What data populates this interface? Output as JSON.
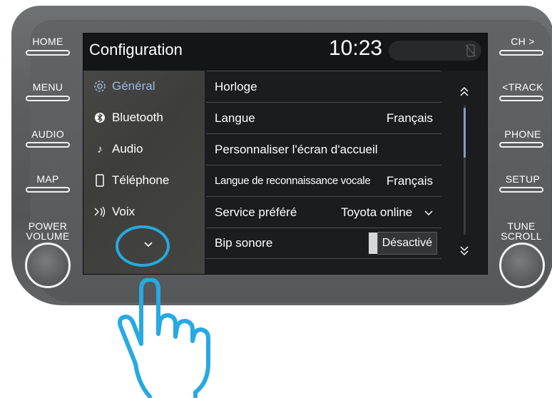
{
  "hardware_buttons": {
    "left": [
      "HOME",
      "MENU",
      "AUDIO",
      "MAP"
    ],
    "right": [
      "CH >",
      "<TRACK",
      "PHONE",
      "SETUP"
    ],
    "left_knob_label": [
      "POWER",
      "VOLUME"
    ],
    "right_knob_label": [
      "TUNE",
      "SCROLL"
    ]
  },
  "screen": {
    "title": "Configuration",
    "clock": "10:23",
    "sidebar": [
      {
        "label": "Général",
        "icon": "gear-icon",
        "active": true
      },
      {
        "label": "Bluetooth",
        "icon": "bluetooth-icon",
        "active": false
      },
      {
        "label": "Audio",
        "icon": "music-note-icon",
        "active": false
      },
      {
        "label": "Téléphone",
        "icon": "phone-icon",
        "active": false
      },
      {
        "label": "Voix",
        "icon": "voice-icon",
        "active": false
      }
    ],
    "settings": [
      {
        "label": "Horloge",
        "value": ""
      },
      {
        "label": "Langue",
        "value": "Français"
      },
      {
        "label": "Personnaliser l'écran d'accueil",
        "value": ""
      },
      {
        "label": "Langue de reconnaissance vocale",
        "value": "Français"
      },
      {
        "label": "Service préféré",
        "value": "Toyota online"
      },
      {
        "label": "Bip sonore",
        "value": "Désactivé"
      }
    ]
  },
  "colors": {
    "highlight": "#27a9e1",
    "active_text": "#9fb7e2"
  }
}
